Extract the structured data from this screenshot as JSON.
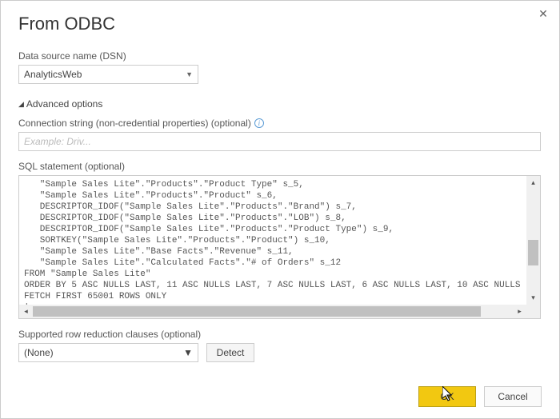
{
  "title": "From ODBC",
  "dsn": {
    "label": "Data source name (DSN)",
    "value": "AnalyticsWeb"
  },
  "advanced": {
    "toggle_label": "Advanced options",
    "expanded": true
  },
  "connection_string": {
    "label": "Connection string (non-credential properties) (optional)",
    "placeholder": "Example: Driv...",
    "value": ""
  },
  "sql": {
    "label": "SQL statement (optional)",
    "lines": [
      "   \"Sample Sales Lite\".\"Products\".\"Product Type\" s_5,",
      "   \"Sample Sales Lite\".\"Products\".\"Product\" s_6,",
      "   DESCRIPTOR_IDOF(\"Sample Sales Lite\".\"Products\".\"Brand\") s_7,",
      "   DESCRIPTOR_IDOF(\"Sample Sales Lite\".\"Products\".\"LOB\") s_8,",
      "   DESCRIPTOR_IDOF(\"Sample Sales Lite\".\"Products\".\"Product Type\") s_9,",
      "   SORTKEY(\"Sample Sales Lite\".\"Products\".\"Product\") s_10,",
      "   \"Sample Sales Lite\".\"Base Facts\".\"Revenue\" s_11,",
      "   \"Sample Sales Lite\".\"Calculated Facts\".\"# of Orders\" s_12",
      "FROM \"Sample Sales Lite\"",
      "ORDER BY 5 ASC NULLS LAST, 11 ASC NULLS LAST, 7 ASC NULLS LAST, 6 ASC NULLS LAST, 10 ASC NULLS",
      "FETCH FIRST 65001 ROWS ONLY"
    ]
  },
  "row_reduction": {
    "label": "Supported row reduction clauses (optional)",
    "value": "(None)",
    "detect_label": "Detect"
  },
  "buttons": {
    "ok": "OK",
    "cancel": "Cancel"
  }
}
